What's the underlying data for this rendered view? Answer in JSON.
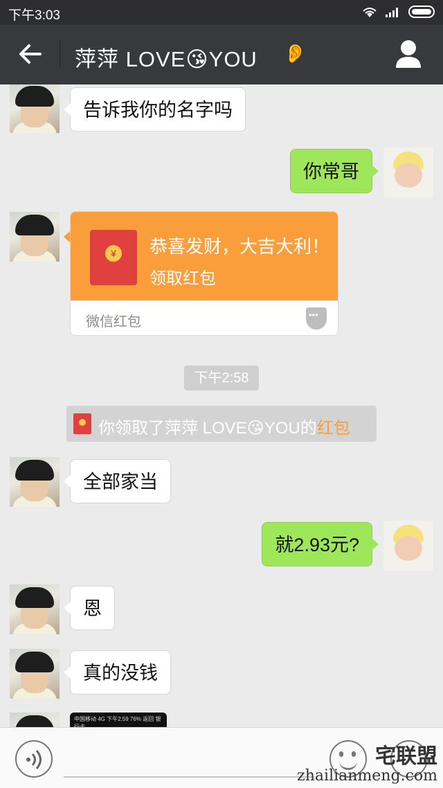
{
  "status_bar": {
    "time": "下午3:03"
  },
  "nav": {
    "title": "萍萍  LOVE😘YOU",
    "ear_icon": "👂"
  },
  "messages": [
    {
      "side": "left",
      "text": "告诉我你的名字吗"
    },
    {
      "side": "right",
      "text": "你常哥"
    },
    {
      "side": "right",
      "text": "就2.93元?"
    },
    {
      "side": "left",
      "text": "全部家当"
    },
    {
      "side": "left",
      "text": "恩"
    },
    {
      "side": "left",
      "text": "真的没钱"
    }
  ],
  "red_packet": {
    "greeting": "恭喜发财，大吉大利！",
    "action": "领取红包",
    "footer": "微信红包",
    "coin": "¥"
  },
  "timestamp": "下午2:58",
  "system_notice": {
    "prefix": "你领取了萍萍  LOVE😘YOU的",
    "link": "红包"
  },
  "partial_image": {
    "text": "中国移动 4G  下午2:59  76%  返回  银行卡"
  },
  "input_bar": {
    "placeholder": ""
  },
  "watermark": {
    "cn": "宅联盟",
    "url": "zhailianmeng.com"
  },
  "colors": {
    "nav_bg": "#38393d",
    "bubble_right": "#9ee75b",
    "red_packet": "#f99e3a"
  }
}
